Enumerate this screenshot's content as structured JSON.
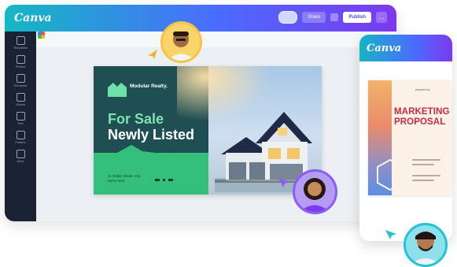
{
  "app": {
    "name": "Canva"
  },
  "toolbar": {
    "share_label": "Share",
    "publish_label": "Publish",
    "more_label": "..."
  },
  "sidebar": {
    "items": [
      {
        "label": "Templates",
        "icon": "templates-icon"
      },
      {
        "label": "Photos",
        "icon": "photos-icon"
      },
      {
        "label": "Elements",
        "icon": "elements-icon"
      },
      {
        "label": "Videos",
        "icon": "videos-icon"
      },
      {
        "label": "Text",
        "icon": "text-icon"
      },
      {
        "label": "Folders",
        "icon": "folder-icon"
      },
      {
        "label": "More",
        "icon": "more-icon"
      }
    ]
  },
  "design": {
    "brand_name": "Modular Realty.",
    "headline_1": "For Sale",
    "headline_2": "Newly Listed",
    "address": "21 Dollar Street, City name here"
  },
  "phone": {
    "app_name": "Canva",
    "document_title": "MARKETING PROPOSAL",
    "document_caption": "prepared by"
  },
  "colors": {
    "topbar_start": "#14b8c4",
    "topbar_end": "#7c3aed",
    "design_teal": "#1f4e53",
    "design_green": "#34c07a",
    "headline_green": "#7ee2b0",
    "proposal_red": "#c8293f"
  }
}
